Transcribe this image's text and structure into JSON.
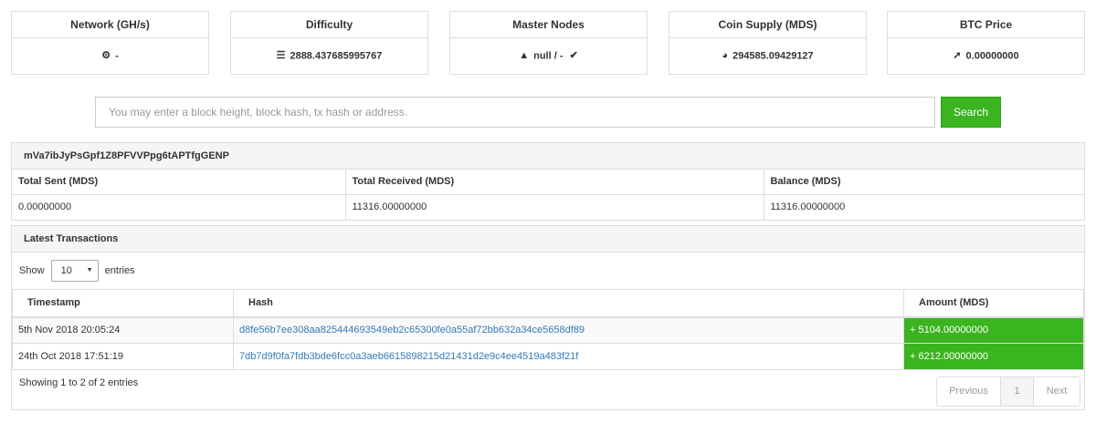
{
  "stats": [
    {
      "title": "Network (GH/s)",
      "icon": "cogs-icon",
      "glyph": "⚙",
      "value": "-"
    },
    {
      "title": "Difficulty",
      "icon": "sliders-icon",
      "glyph": "☰",
      "value": "2888.437685995767"
    },
    {
      "title": "Master Nodes",
      "icon": "warning-icon",
      "glyph": "▲",
      "value": "null / -",
      "trailing_glyph": "✔"
    },
    {
      "title": "Coin Supply (MDS)",
      "icon": "pie-chart-icon",
      "glyph": "◕",
      "value": "294585.09429127"
    },
    {
      "title": "BTC Price",
      "icon": "rocket-icon",
      "glyph": "➚",
      "value": "0.00000000"
    }
  ],
  "search": {
    "placeholder": "You may enter a block height, block hash, tx hash or address.",
    "button": "Search"
  },
  "address": {
    "value": "mVa7ibJyPsGpf1Z8PFVVPpg6tAPTfgGENP",
    "headers": [
      "Total Sent (MDS)",
      "Total Received (MDS)",
      "Balance (MDS)"
    ],
    "values": [
      "0.00000000",
      "11316.00000000",
      "11316.00000000"
    ]
  },
  "transactions": {
    "heading": "Latest Transactions",
    "show_label": "Show",
    "entries_label": "entries",
    "page_size": "10",
    "columns": [
      "Timestamp",
      "Hash",
      "Amount (MDS)"
    ],
    "rows": [
      {
        "timestamp": "5th Nov 2018 20:05:24",
        "hash": "d8fe56b7ee308aa825444693549eb2c65300fe0a55af72bb632a34ce5658df89",
        "amount": "+ 5104.00000000"
      },
      {
        "timestamp": "24th Oct 2018 17:51:19",
        "hash": "7db7d9f0fa7fdb3bde6fcc0a3aeb6615898215d21431d2e9c4ee4519a483f21f",
        "amount": "+ 6212.00000000"
      }
    ],
    "info": "Showing 1 to 2 of 2 entries",
    "pager": {
      "previous": "Previous",
      "page": "1",
      "next": "Next"
    }
  },
  "colors": {
    "accent": "#3ab41f",
    "link": "#337ab7"
  }
}
